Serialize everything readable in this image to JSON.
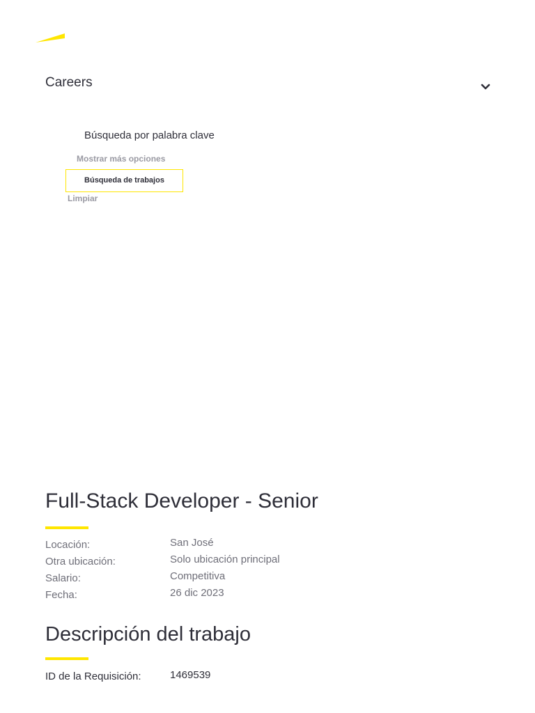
{
  "brand": {
    "logo_icon": "ey-beam-logo",
    "accent_color": "#ffe600"
  },
  "header": {
    "nav_label": "Careers",
    "toggle_icon": "chevron-down-icon"
  },
  "search": {
    "keyword_label": "Búsqueda por palabra clave",
    "more_options_label": "Mostrar más opciones",
    "search_button_label": "Búsqueda de trabajos",
    "clear_label": "Limpiar"
  },
  "job": {
    "title": "Full-Stack Developer - Senior",
    "details": [
      {
        "label": "Locación:",
        "value": "San José"
      },
      {
        "label": "Otra ubicación:",
        "value": "Solo ubicación principal"
      },
      {
        "label": "Salario:",
        "value": "Competitiva"
      },
      {
        "label": "Fecha:",
        "value": "26 dic 2023"
      }
    ],
    "description_heading": "Descripción del trabajo",
    "requisition_label": "ID de la Requisición:",
    "requisition_id": "1469539"
  }
}
